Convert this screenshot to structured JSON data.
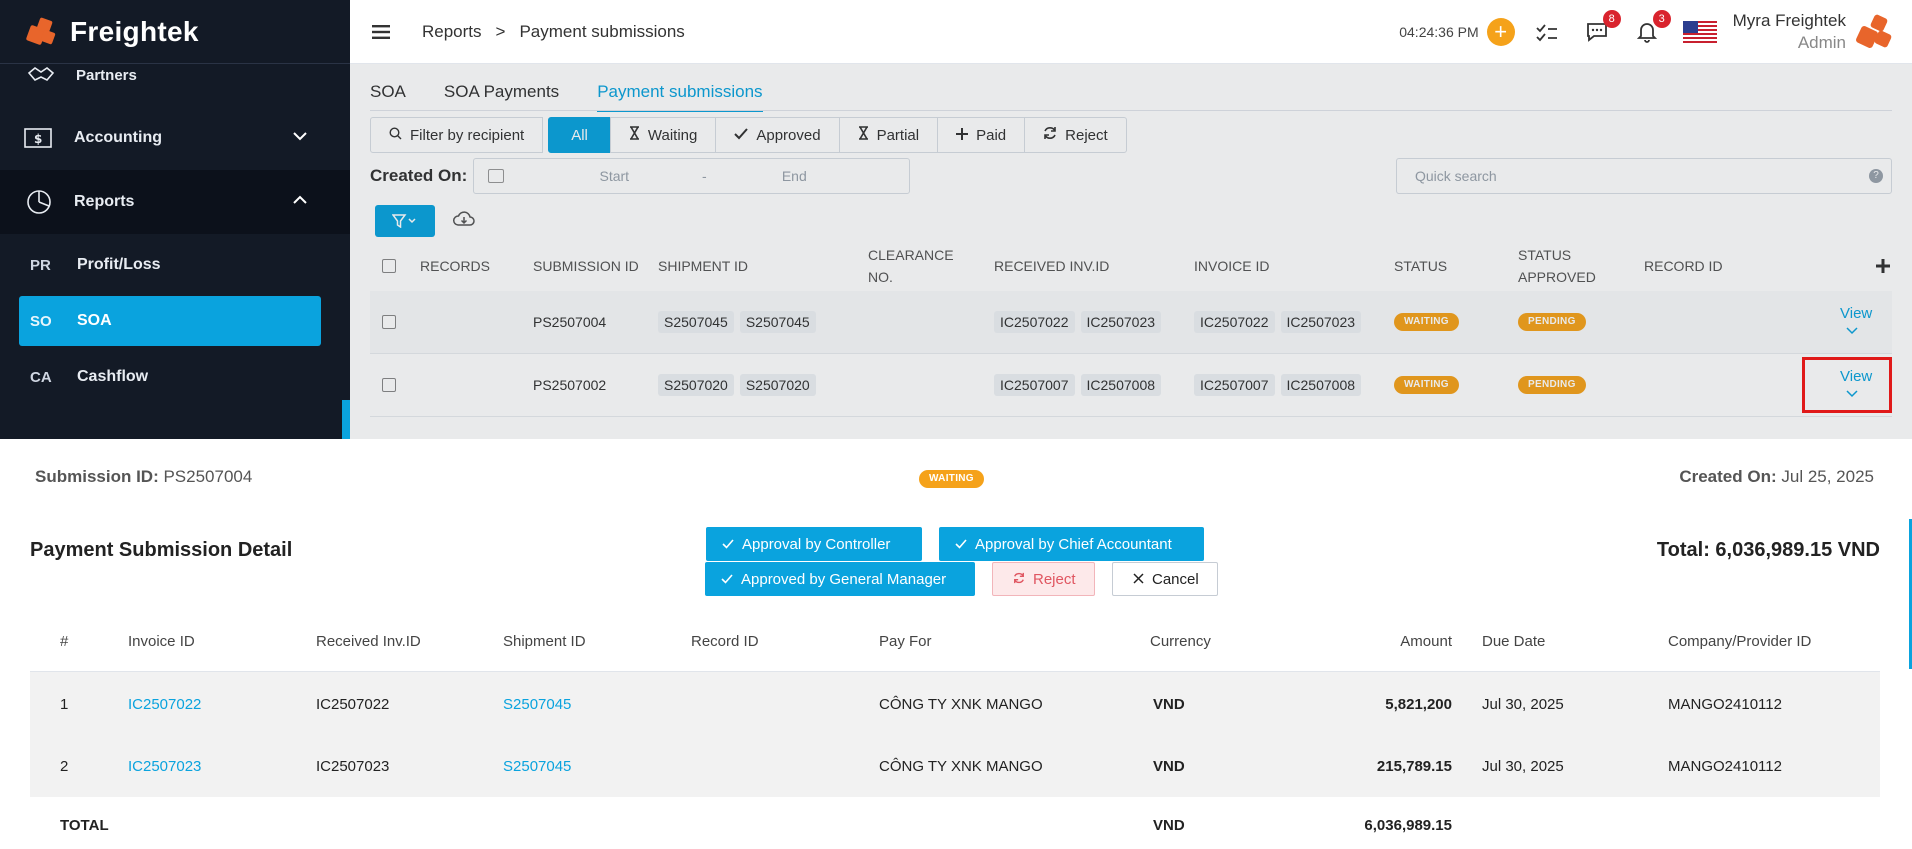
{
  "brand": {
    "name": "Freightek"
  },
  "sidebar": {
    "partners": "Partners",
    "accounting": "Accounting",
    "reports": "Reports",
    "subitems": [
      {
        "code": "PR",
        "label": "Profit/Loss"
      },
      {
        "code": "SO",
        "label": "SOA"
      },
      {
        "code": "CA",
        "label": "Cashflow"
      }
    ]
  },
  "header": {
    "crumb_root": "Reports",
    "crumb_sep": ">",
    "crumb_current": "Payment submissions",
    "clock": "04:24:36 PM",
    "plus": "+",
    "messages_badge": "8",
    "notifications_badge": "3",
    "user_name": "Myra Freightek",
    "user_role": "Admin"
  },
  "tabs": [
    "SOA",
    "SOA Payments",
    "Payment submissions"
  ],
  "filters": {
    "recipient": "Filter by recipient",
    "all": "All",
    "waiting": "Waiting",
    "approved": "Approved",
    "partial": "Partial",
    "paid": "Paid",
    "reject": "Reject"
  },
  "created_on": {
    "label": "Created On:",
    "start": "Start",
    "dash": "-",
    "end": "End"
  },
  "quick_search_placeholder": "Quick search",
  "grid": {
    "columns": [
      "RECORDS",
      "SUBMISSION ID",
      "SHIPMENT ID",
      "CLEARANCE NO.",
      "RECEIVED INV.ID",
      "INVOICE ID",
      "STATUS",
      "STATUS APPROVED",
      "RECORD ID"
    ],
    "rows": [
      {
        "submission": "PS2507004",
        "shipments": [
          "S2507045",
          "S2507045"
        ],
        "received": [
          "IC2507022",
          "IC2507023"
        ],
        "invoices": [
          "IC2507022",
          "IC2507023"
        ],
        "status": "WAITING",
        "approved": "PENDING",
        "action": "View"
      },
      {
        "submission": "PS2507002",
        "shipments": [
          "S2507020",
          "S2507020"
        ],
        "received": [
          "IC2507007",
          "IC2507008"
        ],
        "invoices": [
          "IC2507007",
          "IC2507008"
        ],
        "status": "WAITING",
        "approved": "PENDING",
        "action": "View"
      }
    ]
  },
  "detail": {
    "submission_label": "Submission ID:",
    "submission_id": "PS2507004",
    "status": "WAITING",
    "created_label": "Created On:",
    "created_date": "Jul 25, 2025",
    "title": "Payment Submission Detail",
    "total": "Total: 6,036,989.15 VND",
    "buttons": {
      "controller": "Approval by Controller",
      "chief": "Approval by Chief Accountant",
      "gm": "Approved by General Manager",
      "reject": "Reject",
      "cancel": "Cancel"
    },
    "columns": [
      "#",
      "Invoice ID",
      "Received Inv.ID",
      "Shipment ID",
      "Record ID",
      "Pay For",
      "Currency",
      "Amount",
      "Due Date",
      "Company/Provider ID"
    ],
    "rows": [
      {
        "no": "1",
        "invoice": "IC2507022",
        "received": "IC2507022",
        "shipment": "S2507045",
        "record": "",
        "pay_for": "CÔNG TY XNK MANGO",
        "currency": "VND",
        "amount": "5,821,200",
        "due": "Jul 30, 2025",
        "company": "MANGO2410112"
      },
      {
        "no": "2",
        "invoice": "IC2507023",
        "received": "IC2507023",
        "shipment": "S2507045",
        "record": "",
        "pay_for": "CÔNG TY XNK MANGO",
        "currency": "VND",
        "amount": "215,789.15",
        "due": "Jul 30, 2025",
        "company": "MANGO2410112"
      }
    ],
    "total_row": {
      "label": "TOTAL",
      "currency": "VND",
      "amount": "6,036,989.15"
    }
  },
  "colors": {
    "accent": "#0aa3de",
    "warning": "#f5a21a",
    "sidebar": "#131a26",
    "highlight": "#e01919"
  }
}
